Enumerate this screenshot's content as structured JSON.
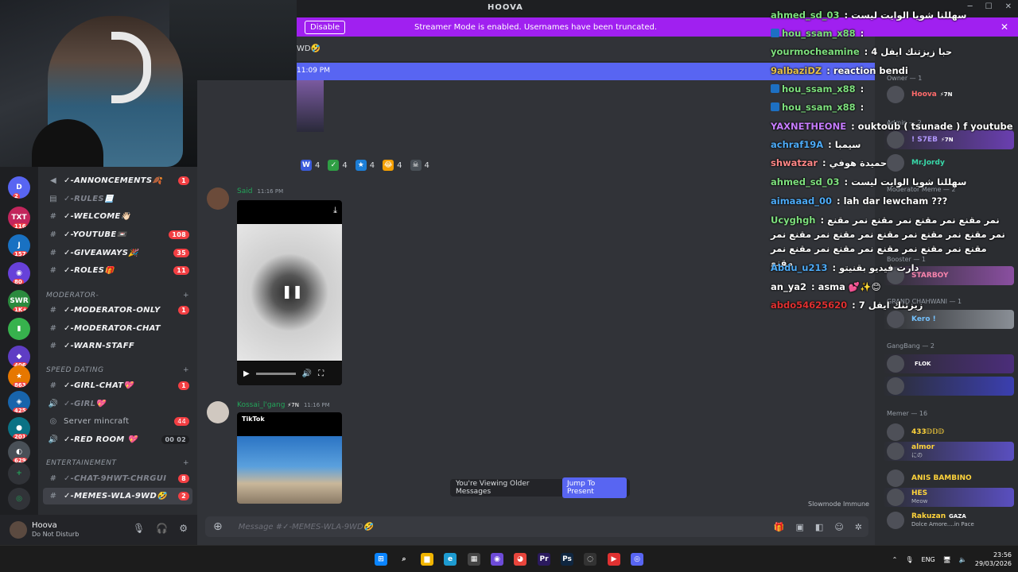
{
  "window": {
    "title": "HOOVA"
  },
  "streamer_bar": {
    "message": "Streamer Mode is enabled. Usernames have been truncated.",
    "button": "Disable",
    "close": "✕"
  },
  "channel_header": {
    "text": "WD🤣"
  },
  "jump_bar": {
    "time": "11:09 PM"
  },
  "reactions": [
    {
      "icon": "W",
      "color": "#3b5bdb",
      "count": "4"
    },
    {
      "icon": "✓",
      "color": "#2f9e44",
      "count": "4"
    },
    {
      "icon": "★",
      "color": "#1c7ed6",
      "count": "4"
    },
    {
      "icon": "😂",
      "color": "#f59f00",
      "count": "4"
    },
    {
      "icon": "☠",
      "color": "#495057",
      "count": "4"
    }
  ],
  "servers": [
    {
      "label": "D",
      "color": "#5865f2",
      "badge": "2"
    },
    {
      "label": "TXT",
      "color": "#c2255c",
      "badge": "116"
    },
    {
      "label": "J",
      "color": "#1971c2",
      "badge": "157"
    },
    {
      "label": "◉",
      "color": "#6741d9",
      "badge": "80"
    },
    {
      "label": "SWR",
      "color": "#2b8a3e",
      "badge": "1K+"
    },
    {
      "label": "▮",
      "color": "#37b24d",
      "badge": ""
    },
    {
      "label": "◆",
      "color": "#5f3dc4",
      "badge": "406"
    },
    {
      "label": "★",
      "color": "#e67700",
      "badge": "863"
    },
    {
      "label": "◈",
      "color": "#1864ab",
      "badge": "425"
    },
    {
      "label": "●",
      "color": "#0b7285",
      "badge": "201"
    },
    {
      "label": "◐",
      "color": "#495057",
      "badge": "629"
    }
  ],
  "channels": [
    {
      "type": "announce",
      "label": "✓-ANNONCEMENTS🍂",
      "count": "1",
      "style": ""
    },
    {
      "type": "rules",
      "label": "✓-RULES📃",
      "count": "",
      "style": "muted"
    },
    {
      "type": "text",
      "label": "✓-WELCOME👋🏻",
      "count": "",
      "style": ""
    },
    {
      "type": "text",
      "label": "✓-YOUTUBE📼",
      "count": "108",
      "style": ""
    },
    {
      "type": "text",
      "label": "✓-GIVEAWAYS🎉",
      "count": "35",
      "style": ""
    },
    {
      "type": "text",
      "label": "✓-ROLES🎁",
      "count": "11",
      "style": ""
    }
  ],
  "cat_moderator": {
    "label": "MODERATOR-"
  },
  "moderator_channels": [
    {
      "label": "✓-MODERATOR-ONLY",
      "count": "1"
    },
    {
      "label": "✓-MODERATOR-CHAT",
      "count": ""
    },
    {
      "label": "✓-WARN-STAFF",
      "count": ""
    }
  ],
  "cat_speed": {
    "label": "SPEED DATING"
  },
  "speed_channels": [
    {
      "icon": "#",
      "label": "✓-GIRL-CHAT💖",
      "count": "1",
      "style": ""
    },
    {
      "icon": "🔊",
      "label": "✓-GIRL💖",
      "count": "",
      "style": "muted"
    },
    {
      "icon": "◎",
      "label": "Server mincraft",
      "count": "44",
      "style": "plain"
    },
    {
      "icon": "🔊",
      "label": "✓-RED ROOM 💖",
      "count": "00 02",
      "style": "room"
    }
  ],
  "cat_entertainment": {
    "label": "ENTERTAINEMENT"
  },
  "ent_channels": [
    {
      "label": "✓-CHAT-9HWT-CHRGUI",
      "count": "8",
      "style": "muted"
    },
    {
      "label": "✓-MEMES-WLA-9WD🤣",
      "count": "2",
      "style": "active"
    }
  ],
  "user": {
    "name": "Hoova",
    "status": "Do Not Disturb"
  },
  "messages": [
    {
      "name": "Said",
      "time": "11:16 PM"
    },
    {
      "name": "Kossai_l'gang",
      "badge": "⚡7N",
      "time": "11:16 PM",
      "video_label": "TikTok"
    }
  ],
  "older_bar": {
    "text": "You're Viewing Older Messages",
    "button": "Jump To Present"
  },
  "slowmode": "Slowmode Immune",
  "composer": {
    "placeholder": "Message #✓-MEMES-WLA-9WD🤣"
  },
  "members": {
    "header": "Owner — 1",
    "owner": [
      {
        "name": "Hoova",
        "tag": "⚡7N",
        "color": "#ff6b6b"
      }
    ],
    "admin_label": "Admin — 2",
    "admin": [
      {
        "name": "! S7EB",
        "tag": "⚡7N",
        "color": "#b197fc"
      },
      {
        "name": "Mr.Jordy",
        "tag": "",
        "color": "#38d9a9"
      }
    ],
    "mod_label": "Moderator Meme — 2",
    "booster_label": "Booster — 1",
    "booster": [
      {
        "name": "STARBOY",
        "tag": "",
        "color": "#f783ac"
      }
    ],
    "grand_label": "GRAND CHAHWANI — 1",
    "grand": [
      {
        "name": "Kero !",
        "tag": "",
        "color": "#74c0fc"
      }
    ],
    "gang_label": "GangBang — 2",
    "gang": [
      {
        "name": "",
        "tag": "FLOK",
        "color": "#ffd43b"
      },
      {
        "name": "",
        "tag": "",
        "color": "#ff922b"
      }
    ],
    "memer_label": "Memer — 16",
    "memer": [
      {
        "name": "433𝔻𝔻𝔻",
        "sub": "",
        "color": "#ffd43b"
      },
      {
        "name": "almor",
        "sub": "にの",
        "color": "#ffd43b"
      },
      {
        "name": "ANIS BAMBINO",
        "sub": "",
        "color": "#ffd43b"
      },
      {
        "name": "HES",
        "sub": "Meow",
        "color": "#ffd43b"
      },
      {
        "name": "Rakuzan",
        "sub": "Dolce Amore....in Pace",
        "color": "#ffd43b",
        "tag": "GAZA"
      }
    ]
  },
  "overlay_chat": [
    {
      "user": "ahmed_sd_03",
      "color": "#7ee07e",
      "text": "سهللنا شويا الوايت ليست",
      "icon": false
    },
    {
      "user": "hou_ssam_x88",
      "color": "#7ee07e",
      "text": "",
      "icon": true
    },
    {
      "user": "yourmocheamine",
      "color": "#7ee07e",
      "text": "4 حبا زيزتنك ايفل",
      "icon": false
    },
    {
      "user": "9albaziDZ",
      "color": "#e6c14a",
      "text": "reaction bendi",
      "icon": false
    },
    {
      "user": "hou_ssam_x88",
      "color": "#7ee07e",
      "text": "",
      "icon": true
    },
    {
      "user": "hou_ssam_x88",
      "color": "#7ee07e",
      "text": "",
      "icon": true
    },
    {
      "user": "YAXNETHEONE",
      "color": "#c77dff",
      "text": "ouktoub ( tsunade ) f youtube",
      "icon": false
    },
    {
      "user": "achraf19A",
      "color": "#4dabf7",
      "text": "سيمبا",
      "icon": false
    },
    {
      "user": "shwatzar",
      "color": "#ff8787",
      "text": "حميدة هوفي",
      "icon": false
    },
    {
      "user": "ahmed_sd_03",
      "color": "#7ee07e",
      "text": "سهللنا شويا الوايت ليست",
      "icon": false
    },
    {
      "user": "aimaaad_00",
      "color": "#4dabf7",
      "text": "lah dar lewcham ???",
      "icon": false
    },
    {
      "user": "Ucyghgh",
      "color": "#7ee07e",
      "text": "نمر مقنع نمر مقنع نمر مقنع نمر مقنع نمر مقنع نمر مقنع نمر مقنع نمر مقنع نمر مقنع نمر مقنع نمر مقنع نمر مقنع نمر مقنع نمر مقنع نمر مقنع",
      "icon": false
    },
    {
      "user": "Abdu_u213",
      "color": "#4dabf7",
      "text": "دارت فيديو بقنيتو",
      "icon": false
    },
    {
      "user": "an_ya2",
      "color": "#ffffff",
      "text": "asma 💕✨😊",
      "icon": false
    },
    {
      "user": "abdo54625620",
      "color": "#e03131",
      "text": "زيزتنك ايفل 7",
      "icon": false
    }
  ],
  "taskbar": {
    "lang": "ENG",
    "time": "23:56",
    "date": "29/03/2026"
  },
  "taskbar_apps": [
    {
      "name": "start",
      "glyph": "⊞",
      "color": "#0a84ff"
    },
    {
      "name": "search",
      "glyph": "⌕",
      "color": "transparent"
    },
    {
      "name": "explorer",
      "glyph": "▆",
      "color": "#f0b400"
    },
    {
      "name": "edge",
      "glyph": "e",
      "color": "#1d9bd1"
    },
    {
      "name": "store",
      "glyph": "▦",
      "color": "#444"
    },
    {
      "name": "discord-alt",
      "glyph": "◉",
      "color": "#6d4bd8"
    },
    {
      "name": "chrome",
      "glyph": "◕",
      "color": "#e8453c"
    },
    {
      "name": "premiere",
      "glyph": "Pr",
      "color": "#2b1a5e"
    },
    {
      "name": "photoshop",
      "glyph": "Ps",
      "color": "#0f2640"
    },
    {
      "name": "capture",
      "glyph": "◌",
      "color": "#333"
    },
    {
      "name": "youtube",
      "glyph": "▶",
      "color": "#e03131"
    },
    {
      "name": "discord",
      "glyph": "◎",
      "color": "#5865f2"
    }
  ]
}
